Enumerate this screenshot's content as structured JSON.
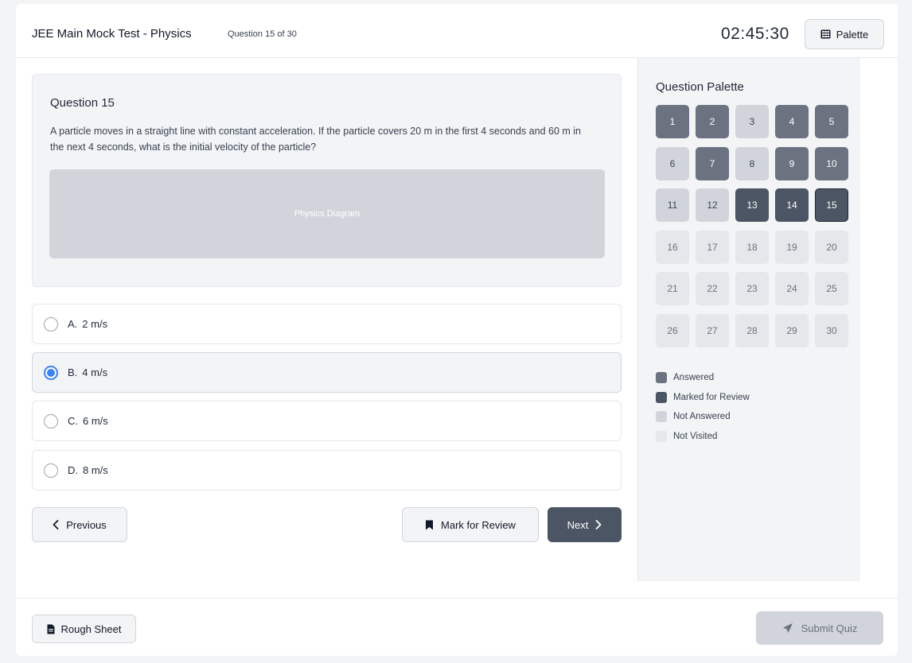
{
  "header": {
    "title": "JEE Main Mock Test - Physics",
    "question_counter": "Question 15 of 30",
    "timer": "02:45:30",
    "palette_button_label": "Palette",
    "palette_button_icon": "grid-icon"
  },
  "question": {
    "heading": "Question 15",
    "text": "A particle moves in a straight line with constant acceleration. If the particle covers 20 m in the first 4 seconds and 60 m in the next 4 seconds, what is the initial velocity of the particle?",
    "diagram_label": "Physics Diagram"
  },
  "options": [
    {
      "label": "A.",
      "text": "2 m/s",
      "selected": false
    },
    {
      "label": "B.",
      "text": "4 m/s",
      "selected": true
    },
    {
      "label": "C.",
      "text": "6 m/s",
      "selected": false
    },
    {
      "label": "D.",
      "text": "8 m/s",
      "selected": false
    }
  ],
  "navigation": {
    "previous_label": "Previous",
    "mark_review_label": "Mark for Review",
    "next_label": "Next"
  },
  "palette": {
    "title": "Question Palette",
    "current": "15",
    "cells": [
      {
        "n": "1",
        "status": "answered"
      },
      {
        "n": "2",
        "status": "answered"
      },
      {
        "n": "3",
        "status": "not-answered"
      },
      {
        "n": "4",
        "status": "answered"
      },
      {
        "n": "5",
        "status": "answered"
      },
      {
        "n": "6",
        "status": "not-answered"
      },
      {
        "n": "7",
        "status": "answered"
      },
      {
        "n": "8",
        "status": "not-answered"
      },
      {
        "n": "9",
        "status": "answered"
      },
      {
        "n": "10",
        "status": "answered"
      },
      {
        "n": "11",
        "status": "not-answered"
      },
      {
        "n": "12",
        "status": "not-answered"
      },
      {
        "n": "13",
        "status": "review"
      },
      {
        "n": "14",
        "status": "review"
      },
      {
        "n": "15",
        "status": "review"
      },
      {
        "n": "16",
        "status": "not-visited"
      },
      {
        "n": "17",
        "status": "not-visited"
      },
      {
        "n": "18",
        "status": "not-visited"
      },
      {
        "n": "19",
        "status": "not-visited"
      },
      {
        "n": "20",
        "status": "not-visited"
      },
      {
        "n": "21",
        "status": "not-visited"
      },
      {
        "n": "22",
        "status": "not-visited"
      },
      {
        "n": "23",
        "status": "not-visited"
      },
      {
        "n": "24",
        "status": "not-visited"
      },
      {
        "n": "25",
        "status": "not-visited"
      },
      {
        "n": "26",
        "status": "not-visited"
      },
      {
        "n": "27",
        "status": "not-visited"
      },
      {
        "n": "28",
        "status": "not-visited"
      },
      {
        "n": "29",
        "status": "not-visited"
      },
      {
        "n": "30",
        "status": "not-visited"
      }
    ],
    "legend": [
      {
        "label": "Answered",
        "color": "#6b7280"
      },
      {
        "label": "Marked for Review",
        "color": "#4b5563"
      },
      {
        "label": "Not Answered",
        "color": "#d1d5db"
      },
      {
        "label": "Not Visited",
        "color": "#e5e7eb"
      }
    ]
  },
  "footer": {
    "rough_sheet_label": "Rough Sheet",
    "submit_label": "Submit Quiz"
  },
  "colors": {
    "accent": "#3b82f6",
    "primary_button": "#4b5563"
  }
}
